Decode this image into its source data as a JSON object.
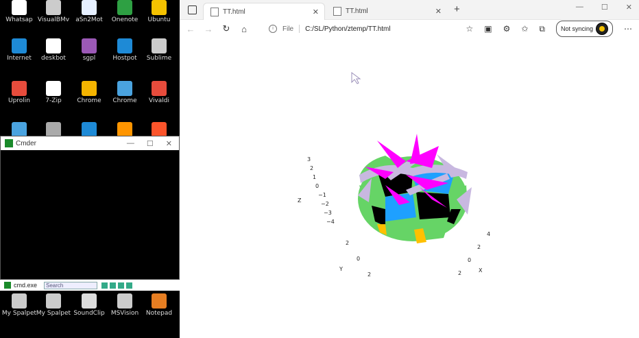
{
  "desktop": {
    "icons": [
      {
        "label": "Whatsap",
        "icon": "app-icon",
        "color": "#ffffff"
      },
      {
        "label": "VisualBMv",
        "icon": "app-icon",
        "color": "#cccccc"
      },
      {
        "label": "aSn2Mot",
        "icon": "document-icon",
        "color": "#e6f0ff"
      },
      {
        "label": "Onenote",
        "icon": "app-icon",
        "color": "#2ea043"
      },
      {
        "label": "Ubuntu",
        "icon": "app-icon",
        "color": "#f5c200"
      },
      {
        "label": "Internet",
        "icon": "ie-icon",
        "color": "#1e8ad6"
      },
      {
        "label": "deskbot",
        "icon": "document-icon",
        "color": "#ffffff"
      },
      {
        "label": "sgpl",
        "icon": "app-icon",
        "color": "#9b59b6"
      },
      {
        "label": "Hostpot",
        "icon": "app-icon",
        "color": "#1e8ad6"
      },
      {
        "label": "Sublime",
        "icon": "app-icon",
        "color": "#cccccc"
      },
      {
        "label": "Uprolin",
        "icon": "lifebuoy-icon",
        "color": "#e74c3c"
      },
      {
        "label": "7-Zip",
        "icon": "zip-icon",
        "color": "#ffffff"
      },
      {
        "label": "Chrome",
        "icon": "chrome-icon",
        "color": "#f4b400"
      },
      {
        "label": "Chrome",
        "icon": "chrome-icon",
        "color": "#4aa3df"
      },
      {
        "label": "Vivaldi",
        "icon": "vivaldi-icon",
        "color": "#e74c3c"
      },
      {
        "label": "",
        "icon": "flag-icon",
        "color": "#4aa3df"
      },
      {
        "label": "",
        "icon": "app-icon",
        "color": "#aaaaaa"
      },
      {
        "label": "",
        "icon": "app-icon",
        "color": "#1e8ad6"
      },
      {
        "label": "",
        "icon": "firefox-icon",
        "color": "#ff9500"
      },
      {
        "label": "",
        "icon": "brave-icon",
        "color": "#fb542b"
      },
      {
        "label": "My Spalpet",
        "icon": "app-icon",
        "color": "#cccccc"
      },
      {
        "label": "My Spalpet",
        "icon": "app-icon",
        "color": "#cccccc"
      },
      {
        "label": "SoundClip",
        "icon": "app-icon",
        "color": "#dddddd"
      },
      {
        "label": "MSVision",
        "icon": "app-icon",
        "color": "#cccccc"
      },
      {
        "label": "Notepad",
        "icon": "app-icon",
        "color": "#e67e22"
      }
    ]
  },
  "cmder": {
    "title": "Cmder",
    "minimize": "—",
    "maximize": "☐",
    "close": "✕",
    "tabbar_title": "cmd.exe",
    "search_placeholder": "Search"
  },
  "browser": {
    "tabs": [
      {
        "title": "TT.html",
        "close": "✕"
      },
      {
        "title": "TT.html",
        "close": "✕"
      }
    ],
    "new_tab": "+",
    "window_controls": [
      "—",
      "☐",
      "✕"
    ],
    "file_label": "File",
    "url": "C:/SL/Python/ztemp/TT.html",
    "sync_label": "Not syncing",
    "more": "⋯",
    "icons": {
      "back": "←",
      "forward": "→",
      "refresh": "↻",
      "home": "⌂",
      "favorite_add": "☆",
      "reading": "▣",
      "extensions": "⚙",
      "favorites": "✩",
      "collections": "⧉"
    }
  },
  "plot": {
    "colors": {
      "magenta": "#ff00ff",
      "lavender": "#c8b8e0",
      "green": "#66d466",
      "blue": "#1ea0ff",
      "black": "#000000",
      "yellow": "#ffc000"
    },
    "z_axis": {
      "label": "Z",
      "ticks": [
        "3",
        "2",
        "1",
        "0",
        "−1",
        "−2",
        "−3",
        "−4"
      ]
    },
    "y_axis": {
      "label": "Y",
      "ticks": [
        "2",
        "0",
        "2"
      ]
    },
    "x_axis": {
      "label": "X",
      "ticks": [
        "4",
        "2",
        "0",
        "2"
      ]
    }
  }
}
